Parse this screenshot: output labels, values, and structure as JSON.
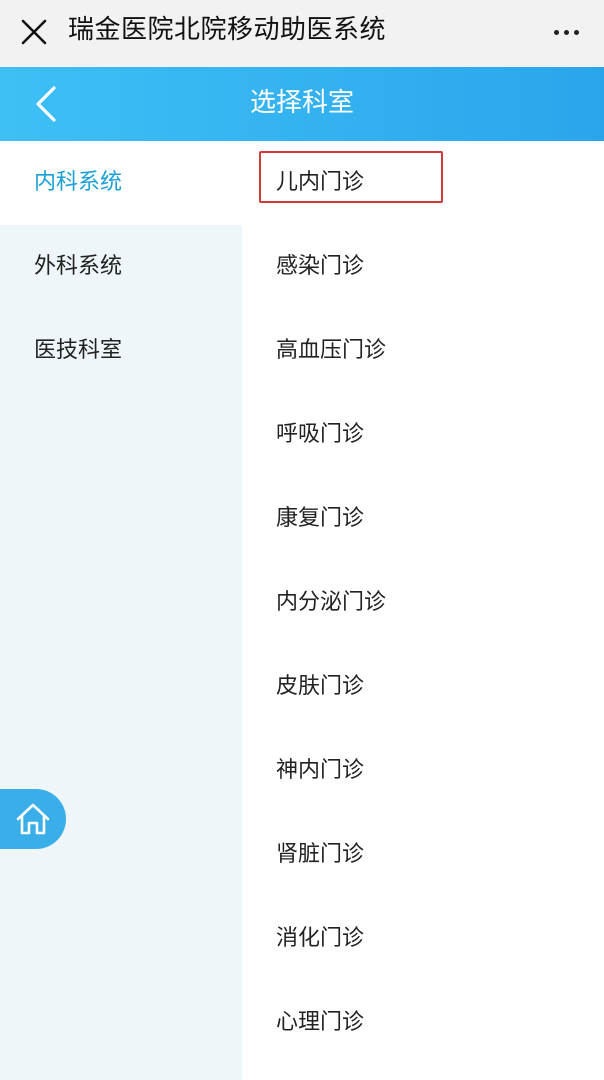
{
  "window": {
    "title": "瑞金医院北院移动助医系统",
    "close_icon": "close-icon",
    "more_icon": "more-dots-icon"
  },
  "navbar": {
    "title": "选择科室",
    "back_icon": "chevron-left-icon",
    "accent_color": "#2aa5ec"
  },
  "sidebar": {
    "selected_index": 0,
    "active_color": "#1aa0d8",
    "items": [
      {
        "label": "内科系统"
      },
      {
        "label": "外科系统"
      },
      {
        "label": "医技科室"
      }
    ]
  },
  "departments": {
    "highlight_color": "#d23a3a",
    "items": [
      {
        "label": "儿内门诊"
      },
      {
        "label": "感染门诊"
      },
      {
        "label": "高血压门诊"
      },
      {
        "label": "呼吸门诊"
      },
      {
        "label": "康复门诊"
      },
      {
        "label": "内分泌门诊"
      },
      {
        "label": "皮肤门诊"
      },
      {
        "label": "神内门诊"
      },
      {
        "label": "肾脏门诊"
      },
      {
        "label": "消化门诊"
      },
      {
        "label": "心理门诊"
      }
    ]
  },
  "home_button": {
    "icon": "home-icon"
  }
}
